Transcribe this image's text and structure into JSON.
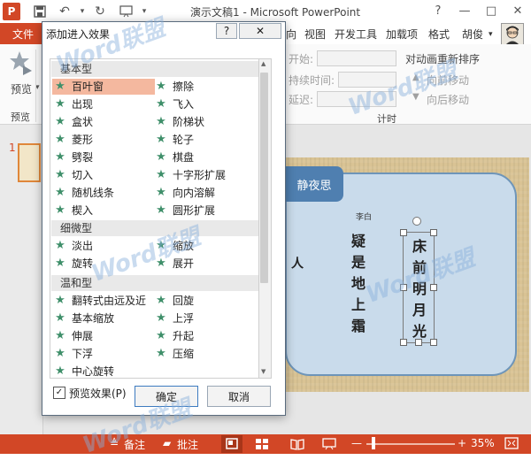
{
  "app": {
    "title": "演示文稿1 - Microsoft PowerPoint",
    "logo": "P",
    "file_tab": "文件",
    "tabs": [
      "向",
      "视图",
      "开发工具",
      "加载项",
      "格式",
      "胡俊"
    ],
    "quick_access": [
      "save-icon",
      "undo-icon",
      "redo-icon",
      "start-icon"
    ],
    "window_buttons": [
      "?",
      "—",
      "□",
      "✕"
    ]
  },
  "ribbon": {
    "preview_label": "预览",
    "preview_group": "预览",
    "start_label": "开始:",
    "duration_label": "持续时间:",
    "delay_label": "延迟:",
    "reorder_title": "对动画重新排序",
    "move_earlier": "向前移动",
    "move_later": "向后移动",
    "timing_group": "计时"
  },
  "slide": {
    "thumb_number": "1",
    "banner": "静夜思",
    "author": "李白",
    "line3": "疑是地上霜",
    "line4": "床前明月光",
    "partial_left": "人"
  },
  "status": {
    "notes": "备注",
    "comments": "批注",
    "zoom": "35%",
    "minus": "—",
    "plus": "+"
  },
  "dialog": {
    "title": "添加进入效果",
    "help": "?",
    "close": "✕",
    "categories": [
      {
        "name": "基本型",
        "left": [
          "百叶窗",
          "出现",
          "盒状",
          "菱形",
          "劈裂",
          "切入",
          "随机线条",
          "楔入"
        ],
        "right": [
          "擦除",
          "飞入",
          "阶梯状",
          "轮子",
          "棋盘",
          "十字形扩展",
          "向内溶解",
          "圆形扩展"
        ]
      },
      {
        "name": "细微型",
        "left": [
          "淡出",
          "旋转"
        ],
        "right": [
          "缩放",
          "展开"
        ]
      },
      {
        "name": "温和型",
        "left": [
          "翻转式由远及近",
          "基本缩放",
          "伸展",
          "下浮",
          "中心旋转"
        ],
        "right": [
          "回旋",
          "上浮",
          "升起",
          "压缩"
        ]
      }
    ],
    "selected": "百叶窗",
    "preview_checkbox": "预览效果(P)",
    "preview_checked": true,
    "ok": "确定",
    "cancel": "取消"
  },
  "watermark": "Word联盟",
  "colors": {
    "accent": "#d24726",
    "selected_item": "#f4b89f",
    "star": "#3f8f6a",
    "slide_card": "#c9dbeb",
    "banner": "#4f7fb0"
  }
}
